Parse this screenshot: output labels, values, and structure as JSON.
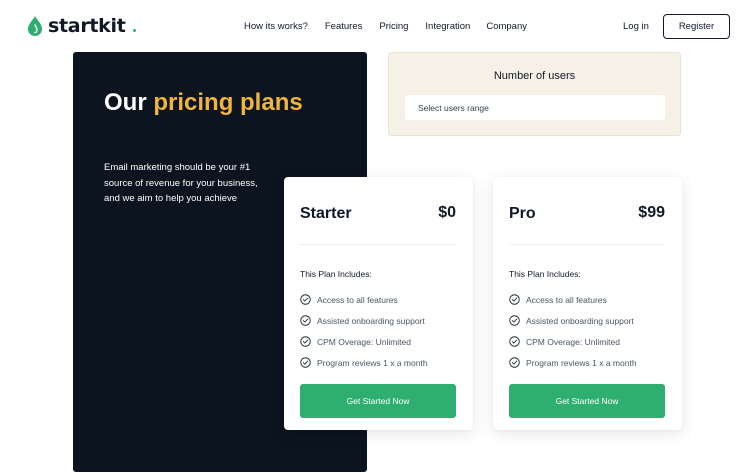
{
  "header": {
    "logo_text": "startkit",
    "nav": [
      "How its works?",
      "Features",
      "Pricing",
      "Integration",
      "Company"
    ],
    "login_label": "Log in",
    "register_label": "Register"
  },
  "hero": {
    "title_plain": "Our ",
    "title_accent": "pricing plans",
    "description": "Email marketing should be your #1 source of revenue for your business, and we aim to help you achieve"
  },
  "users": {
    "title": "Number of users",
    "placeholder": "Select users range"
  },
  "plans": [
    {
      "name": "Starter",
      "price": "$0",
      "includes_label": "This Plan Includes:",
      "features": [
        "Access to all features",
        "Assisted onboarding support",
        "CPM Overage: Unlimited",
        "Program reviews 1 x a month"
      ],
      "cta": "Get Started Now"
    },
    {
      "name": "Pro",
      "price": "$99",
      "includes_label": "This Plan Includes:",
      "features": [
        "Access to all features",
        "Assisted onboarding support",
        "CPM Overage: Unlimited",
        "Program reviews 1 x a month"
      ],
      "cta": "Get Started Now"
    }
  ],
  "colors": {
    "brand_green": "#2eae6f",
    "accent_yellow": "#f2b43a",
    "dark_panel": "#0b141f",
    "users_box_bg": "#f6f1e6"
  },
  "icons": {
    "logo": "leaf-drop-icon",
    "feature": "check-circle-icon"
  }
}
